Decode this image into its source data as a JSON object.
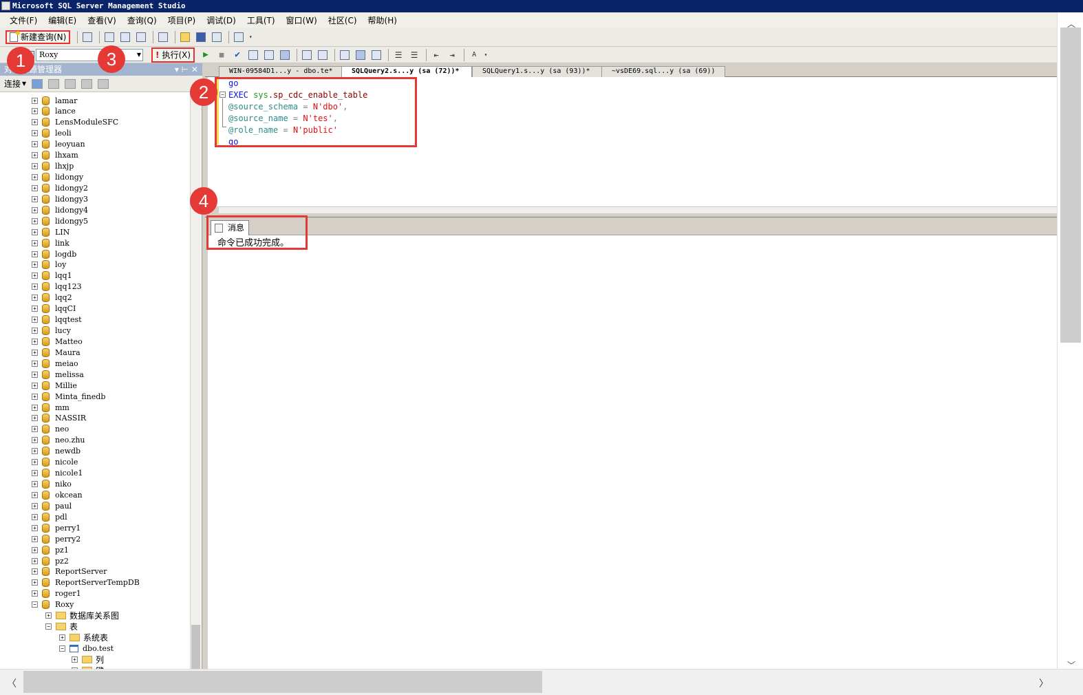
{
  "window": {
    "title": "Microsoft SQL Server Management Studio"
  },
  "menu": [
    "文件(F)",
    "编辑(E)",
    "查看(V)",
    "查询(Q)",
    "项目(P)",
    "调试(D)",
    "工具(T)",
    "窗口(W)",
    "社区(C)",
    "帮助(H)"
  ],
  "toolbar": {
    "new_query_label": "新建查询(N)",
    "database": "Roxy",
    "execute_label": "执行(X)"
  },
  "object_explorer": {
    "title": "对象资源管理器",
    "connect_label": "连接",
    "databases": [
      "lamar",
      "lance",
      "LensModuleSFC",
      "leoli",
      "leoyuan",
      "lhxam",
      "lhxjp",
      "lidongy",
      "lidongy2",
      "lidongy3",
      "lidongy4",
      "lidongy5",
      "LIN",
      "link",
      "logdb",
      "loy",
      "lqq1",
      "lqq123",
      "lqq2",
      "lqqCI",
      "lqqtest",
      "lucy",
      "Matteo",
      "Maura",
      "meiao",
      "melissa",
      "Millie",
      "Minta_finedb",
      "mm",
      "NASSIR",
      "neo",
      "neo.zhu",
      "newdb",
      "nicole",
      "nicole1",
      "niko",
      "okcean",
      "paul",
      "pdl",
      "perry1",
      "perry2",
      "pz1",
      "pz2",
      "ReportServer",
      "ReportServerTempDB",
      "roger1",
      "Roxy"
    ],
    "roxy_children": {
      "diagrams": "数据库关系图",
      "tables": "表",
      "system_tables": "系统表",
      "table_name": "dbo.test",
      "columns": "列",
      "keys": "键"
    }
  },
  "tabs": [
    {
      "label": "WIN-09584D1...y - dbo.te*",
      "active": false
    },
    {
      "label": "SQLQuery2.s...y (sa (72))*",
      "active": true
    },
    {
      "label": "SQLQuery1.s...y (sa (93))*",
      "active": false
    },
    {
      "label": "~vsDE69.sql...y (sa (69))",
      "active": false
    }
  ],
  "editor": {
    "line1_go": "go",
    "line2_exec": "EXEC",
    "line2_sys": "sys",
    "line2_proc": ".sp_cdc_enable_table",
    "line3_param": "@source_schema",
    "line3_eq": " = ",
    "line3_val": "N'dbo'",
    "line3_comma": ",",
    "line4_param": "@source_name",
    "line4_eq": " = ",
    "line4_val": "N'tes'",
    "line4_comma": ",",
    "line5_param": "@role_name",
    "line5_eq": " = ",
    "line5_val": "N'public'",
    "line6_go": "go"
  },
  "results": {
    "tab_label": "消息",
    "message": "命令已成功完成。"
  },
  "annotations": [
    "1",
    "2",
    "3",
    "4"
  ],
  "colors": {
    "titlebar": "#0a246a",
    "callout": "#e53935",
    "keyword": "#1010d8",
    "string": "#e01010"
  }
}
